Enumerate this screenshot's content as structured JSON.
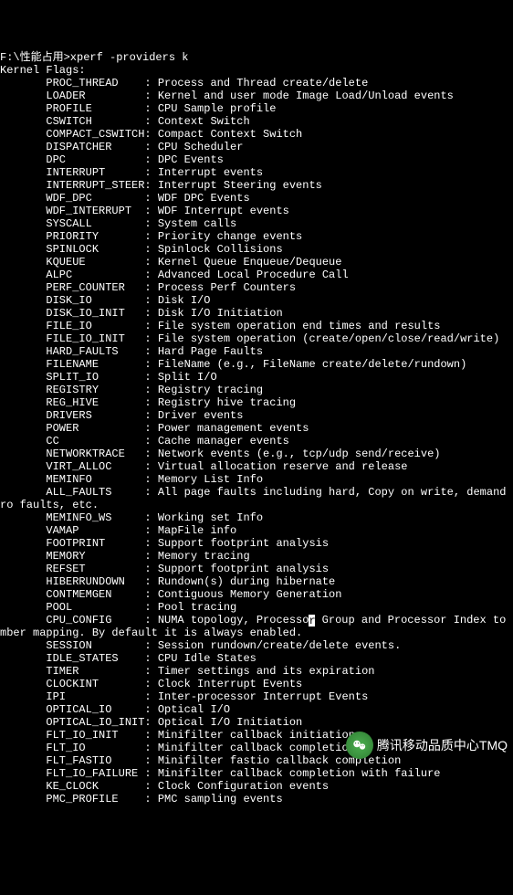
{
  "prompt": "F:\\性能占用>xperf -providers k",
  "header": "Kernel Flags:",
  "flags": [
    {
      "name": "PROC_THREAD",
      "desc": "Process and Thread create/delete"
    },
    {
      "name": "LOADER",
      "desc": "Kernel and user mode Image Load/Unload events"
    },
    {
      "name": "PROFILE",
      "desc": "CPU Sample profile"
    },
    {
      "name": "CSWITCH",
      "desc": "Context Switch"
    },
    {
      "name": "COMPACT_CSWITCH",
      "desc": "Compact Context Switch"
    },
    {
      "name": "DISPATCHER",
      "desc": "CPU Scheduler"
    },
    {
      "name": "DPC",
      "desc": "DPC Events"
    },
    {
      "name": "INTERRUPT",
      "desc": "Interrupt events"
    },
    {
      "name": "INTERRUPT_STEER",
      "desc": "Interrupt Steering events"
    },
    {
      "name": "WDF_DPC",
      "desc": "WDF DPC Events"
    },
    {
      "name": "WDF_INTERRUPT",
      "desc": "WDF Interrupt events"
    },
    {
      "name": "SYSCALL",
      "desc": "System calls"
    },
    {
      "name": "PRIORITY",
      "desc": "Priority change events"
    },
    {
      "name": "SPINLOCK",
      "desc": "Spinlock Collisions"
    },
    {
      "name": "KQUEUE",
      "desc": "Kernel Queue Enqueue/Dequeue"
    },
    {
      "name": "ALPC",
      "desc": "Advanced Local Procedure Call"
    },
    {
      "name": "PERF_COUNTER",
      "desc": "Process Perf Counters"
    },
    {
      "name": "DISK_IO",
      "desc": "Disk I/O"
    },
    {
      "name": "DISK_IO_INIT",
      "desc": "Disk I/O Initiation"
    },
    {
      "name": "FILE_IO",
      "desc": "File system operation end times and results"
    },
    {
      "name": "FILE_IO_INIT",
      "desc": "File system operation (create/open/close/read/write)"
    },
    {
      "name": "HARD_FAULTS",
      "desc": "Hard Page Faults"
    },
    {
      "name": "FILENAME",
      "desc": "FileName (e.g., FileName create/delete/rundown)"
    },
    {
      "name": "SPLIT_IO",
      "desc": "Split I/O"
    },
    {
      "name": "REGISTRY",
      "desc": "Registry tracing"
    },
    {
      "name": "REG_HIVE",
      "desc": "Registry hive tracing"
    },
    {
      "name": "DRIVERS",
      "desc": "Driver events"
    },
    {
      "name": "POWER",
      "desc": "Power management events"
    },
    {
      "name": "CC",
      "desc": "Cache manager events"
    },
    {
      "name": "NETWORKTRACE",
      "desc": "Network events (e.g., tcp/udp send/receive)"
    },
    {
      "name": "VIRT_ALLOC",
      "desc": "Virtual allocation reserve and release"
    },
    {
      "name": "MEMINFO",
      "desc": "Memory List Info"
    },
    {
      "name": "ALL_FAULTS",
      "desc": "All page faults including hard, Copy on write, demand ze",
      "cont": "ro faults, etc."
    },
    {
      "name": "MEMINFO_WS",
      "desc": "Working set Info"
    },
    {
      "name": "VAMAP",
      "desc": "MapFile info"
    },
    {
      "name": "FOOTPRINT",
      "desc": "Support footprint analysis"
    },
    {
      "name": "MEMORY",
      "desc": "Memory tracing"
    },
    {
      "name": "REFSET",
      "desc": "Support footprint analysis"
    },
    {
      "name": "HIBERRUNDOWN",
      "desc": "Rundown(s) during hibernate"
    },
    {
      "name": "CONTMEMGEN",
      "desc": "Contiguous Memory Generation"
    },
    {
      "name": "POOL",
      "desc": "Pool tracing"
    },
    {
      "name": "CPU_CONFIG",
      "desc": "NUMA topology, Processor Group and Processor Index to Nu",
      "cont": "mber mapping. By default it is always enabled.",
      "cursor_at": 23
    },
    {
      "name": "SESSION",
      "desc": "Session rundown/create/delete events."
    },
    {
      "name": "IDLE_STATES",
      "desc": "CPU Idle States"
    },
    {
      "name": "TIMER",
      "desc": "Timer settings and its expiration"
    },
    {
      "name": "CLOCKINT",
      "desc": "Clock Interrupt Events"
    },
    {
      "name": "IPI",
      "desc": "Inter-processor Interrupt Events"
    },
    {
      "name": "OPTICAL_IO",
      "desc": "Optical I/O"
    },
    {
      "name": "OPTICAL_IO_INIT",
      "desc": "Optical I/O Initiation"
    },
    {
      "name": "FLT_IO_INIT",
      "desc": "Minifilter callback initiation"
    },
    {
      "name": "FLT_IO",
      "desc": "Minifilter callback completion"
    },
    {
      "name": "FLT_FASTIO",
      "desc": "Minifilter fastio callback completion"
    },
    {
      "name": "FLT_IO_FAILURE",
      "desc": "Minifilter callback completion with failure"
    },
    {
      "name": "KE_CLOCK",
      "desc": "Clock Configuration events"
    },
    {
      "name": "PMC_PROFILE",
      "desc": "PMC sampling events"
    }
  ],
  "watermark": "腾讯移动品质中心TMQ"
}
